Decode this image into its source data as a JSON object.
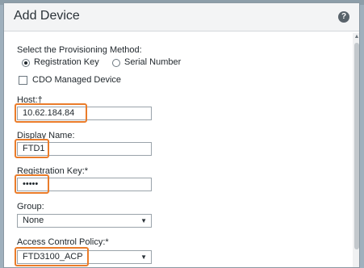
{
  "dialog": {
    "title": "Add Device",
    "help_icon": "?"
  },
  "provisioning": {
    "label": "Select the Provisioning Method:",
    "options": [
      {
        "label": "Registration Key",
        "selected": true
      },
      {
        "label": "Serial Number",
        "selected": false
      }
    ]
  },
  "cdo": {
    "label": "CDO Managed Device",
    "checked": false
  },
  "host": {
    "label": "Host:†",
    "value": "10.62.184.84"
  },
  "display_name": {
    "label": "Display Name:",
    "value": "FTD1"
  },
  "registration_key": {
    "label": "Registration Key:*",
    "value": "•••••"
  },
  "group": {
    "label": "Group:",
    "value": "None"
  },
  "access_control_policy": {
    "label": "Access Control Policy:*",
    "value": "FTD3100_ACP"
  },
  "colors": {
    "highlight": "#ea7c2a",
    "header_bg": "#f3f4f5",
    "help_icon_bg": "#59636b"
  }
}
